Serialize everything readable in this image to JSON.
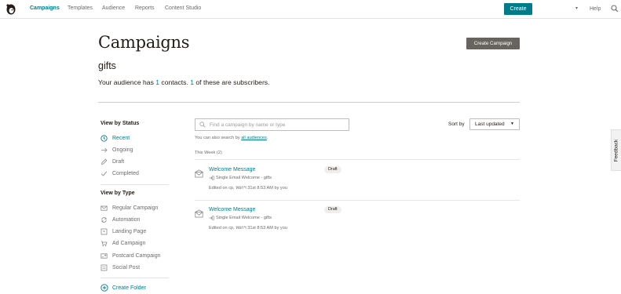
{
  "nav": {
    "items": [
      {
        "label": "Campaigns",
        "active": true
      },
      {
        "label": "Templates",
        "active": false
      },
      {
        "label": "Audience",
        "active": false
      },
      {
        "label": "Reports",
        "active": false
      },
      {
        "label": "Content Studio",
        "active": false
      }
    ],
    "create_label": "Create",
    "help_label": "Help",
    "account_caret": "▾"
  },
  "header": {
    "title": "Campaigns",
    "create_campaign_label": "Create Campaign",
    "audience_name": "gifts",
    "summary": {
      "prefix": "Your audience has ",
      "contacts": "1",
      "middle": " contacts. ",
      "subscribers": "1",
      "suffix": " of these are subscribers."
    }
  },
  "sidebar": {
    "status_heading": "View by Status",
    "status_items": [
      {
        "label": "Recent",
        "icon": "clock-icon",
        "active": true
      },
      {
        "label": "Ongoing",
        "icon": "arrow-right-icon",
        "active": false
      },
      {
        "label": "Draft",
        "icon": "pencil-icon",
        "active": false
      },
      {
        "label": "Completed",
        "icon": "checkmark-icon",
        "active": false
      }
    ],
    "type_heading": "View by Type",
    "type_items": [
      {
        "label": "Regular Campaign",
        "icon": "envelope-icon"
      },
      {
        "label": "Automation",
        "icon": "automation-icon"
      },
      {
        "label": "Landing Page",
        "icon": "landing-page-icon"
      },
      {
        "label": "Ad Campaign",
        "icon": "ad-icon"
      },
      {
        "label": "Postcard Campaign",
        "icon": "postcard-icon"
      },
      {
        "label": "Social Post",
        "icon": "social-post-icon"
      }
    ],
    "create_folder_label": "Create Folder"
  },
  "main": {
    "search": {
      "placeholder": "Find a campaign by name or type"
    },
    "search_hint": {
      "prefix": "You can also search by ",
      "link": "all audiences",
      "suffix": "."
    },
    "sort": {
      "label": "Sort by",
      "selected": "Last updated"
    },
    "section_label": "This Week (2)",
    "campaigns": [
      {
        "title": "Welcome Message",
        "type": "Single Email Welcome - gifts",
        "edited": "Edited on cp, หยกฯ 31st 8:53 AM by you",
        "status": "Draft"
      },
      {
        "title": "Welcome Message",
        "type": "Single Email Welcome - gifts",
        "edited": "Edited on cp, หยกฯ 31st 8:53 AM by you",
        "status": "Draft"
      }
    ]
  },
  "feedback_label": "Feedback",
  "colors": {
    "accent": "#007c89",
    "dark_button": "#67645f",
    "text": "#241c15",
    "muted": "#6b6b6b"
  }
}
